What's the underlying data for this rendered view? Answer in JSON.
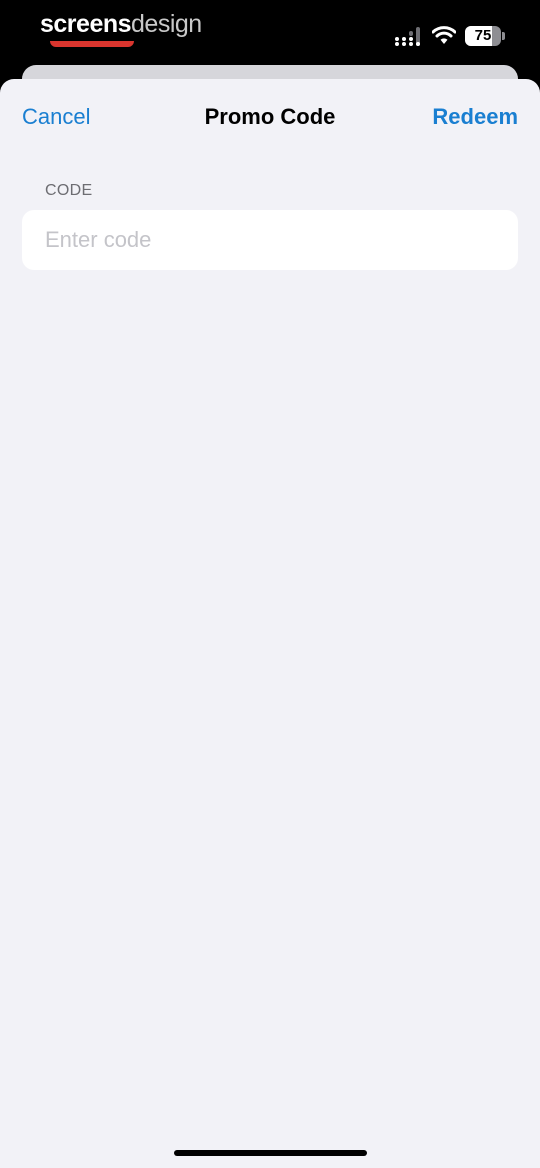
{
  "status_bar": {
    "brand_part1": "screens",
    "brand_part2": "design",
    "battery_level": "75",
    "battery_fraction": 0.75,
    "icons": [
      "signal-icon",
      "wifi-icon",
      "battery-icon"
    ]
  },
  "nav": {
    "cancel_label": "Cancel",
    "title": "Promo Code",
    "redeem_label": "Redeem"
  },
  "form": {
    "section_label": "CODE",
    "input_value": "",
    "input_placeholder": "Enter code"
  },
  "colors": {
    "accent": "#1a7fd1",
    "sheet_background": "#f2f2f7",
    "brand_underline": "#d9352e"
  }
}
